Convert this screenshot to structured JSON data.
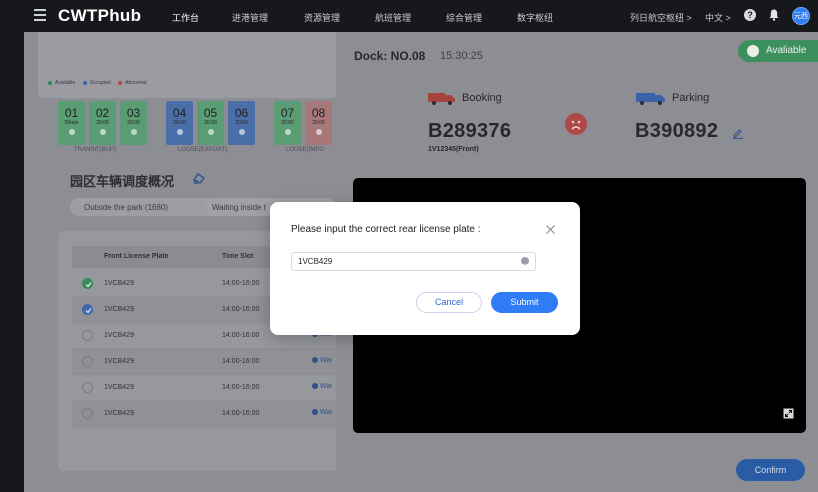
{
  "topbar": {
    "logo": "CWTPhub",
    "nav": [
      "工作台",
      "进港管理",
      "资源管理",
      "航班管理",
      "综合管理",
      "数字枢纽"
    ],
    "active_nav": "工作台",
    "hub_selector": "列日航空枢纽 >",
    "language": "中文 >",
    "help_icon": "?",
    "avatar": "元西"
  },
  "legend": {
    "available": "Available",
    "occupied": "Occupied",
    "abnormal": "Abnormal",
    "colors": {
      "available": "#2fa35c",
      "occupied": "#2d6fd6",
      "abnormal": "#d64545"
    }
  },
  "docks": [
    {
      "num": "01",
      "time": "50min",
      "status": "available"
    },
    {
      "num": "02",
      "time": "20:00",
      "status": "available"
    },
    {
      "num": "03",
      "time": "20:00",
      "status": "available"
    },
    {
      "num": "04",
      "time": "20:00",
      "status": "occupied"
    },
    {
      "num": "05",
      "time": "20:00",
      "status": "available"
    },
    {
      "num": "06",
      "time": "20:00",
      "status": "occupied"
    },
    {
      "num": "07",
      "time": "20:00",
      "status": "available"
    },
    {
      "num": "08",
      "time": "20:00",
      "status": "abnormal"
    }
  ],
  "dock_groups": [
    "TRANSIT(BUP)",
    "LOOSE(EXPORT)",
    "LOOSE(IMPO"
  ],
  "section": {
    "title": "园区车辆调度概况"
  },
  "tabs": {
    "outside": "Outside the park (1680)",
    "waiting": "Waiting inside t"
  },
  "table": {
    "headers": {
      "plate": "Front License Plate",
      "slot": "Time Slot"
    },
    "rows": [
      {
        "plate": "1VCB429",
        "slot": "14:00-16:00",
        "state": "green",
        "wait": ""
      },
      {
        "plate": "1VCB429",
        "slot": "14:00-16:00",
        "state": "blue",
        "wait": ""
      },
      {
        "plate": "1VCB429",
        "slot": "14:00-16:00",
        "state": "none",
        "wait": "Wai"
      },
      {
        "plate": "1VCB429",
        "slot": "14:00-16:00",
        "state": "none",
        "wait": "Wai"
      },
      {
        "plate": "1VCB429",
        "slot": "14:00-16:00",
        "state": "none",
        "wait": "Wai"
      },
      {
        "plate": "1VCB429",
        "slot": "14:00-16:00",
        "state": "none",
        "wait": "Wai"
      }
    ]
  },
  "drawer": {
    "dock_title": "Dock: NO.08",
    "time": "15:30:25",
    "badge": "Avaliable",
    "booking_label": "Booking",
    "booking_plate": "B289376",
    "booking_sub": "1V12345(Front)",
    "parking_label": "Parking",
    "parking_plate": "B390892",
    "confirm": "Confirm"
  },
  "dialog": {
    "title": "Please input the correct rear license plate :",
    "input_value": "1VCB429",
    "cancel": "Cancel",
    "submit": "Submit"
  }
}
